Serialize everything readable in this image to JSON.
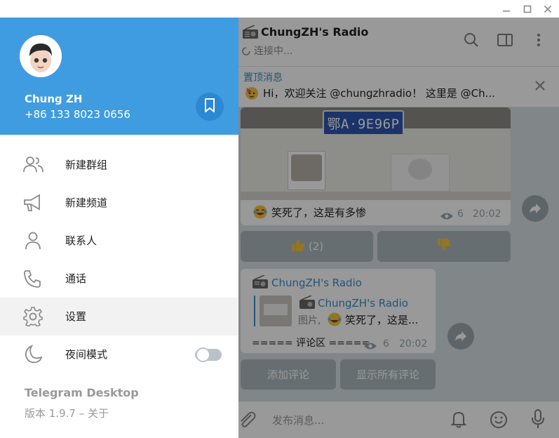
{
  "chat": {
    "title": "ChungZH's Radio",
    "status": "连接中...",
    "pinned_label": "置顶消息",
    "pinned_text": "Hi，欢迎关注 @chungzhradio！ 这里是 @Ch...",
    "post1": {
      "plate": "鄂A·9E96P",
      "caption": "笑死了，这是有多惨",
      "views": "6",
      "time": "20:02",
      "reaction_like": "(2)"
    },
    "post2": {
      "channel": "ChungZH's Radio",
      "reply_channel": "ChungZH's Radio",
      "reply_prefix": "图片,",
      "reply_text": "笑死了，这是...",
      "body": "===== 评论区 =====",
      "views": "6",
      "time": "20:02"
    },
    "btn_add_comment": "添加评论",
    "btn_show_comments": "显示所有评论",
    "composer_placeholder": "发布消息..."
  },
  "menu": {
    "user_name": "Chung ZH",
    "user_phone": "+86 133 8023 0656",
    "items": [
      {
        "label": "新建群组",
        "icon": "group-icon"
      },
      {
        "label": "新建频道",
        "icon": "megaphone-icon"
      },
      {
        "label": "联系人",
        "icon": "contact-icon"
      },
      {
        "label": "通话",
        "icon": "phone-icon"
      },
      {
        "label": "设置",
        "icon": "gear-icon"
      },
      {
        "label": "夜间模式",
        "icon": "moon-icon"
      }
    ],
    "night_mode_on": false,
    "app_name": "Telegram Desktop",
    "app_version": "版本 1.9.7 – 关于"
  },
  "colors": {
    "header_blue": "#409ce0",
    "accent": "#3a8fc9"
  }
}
